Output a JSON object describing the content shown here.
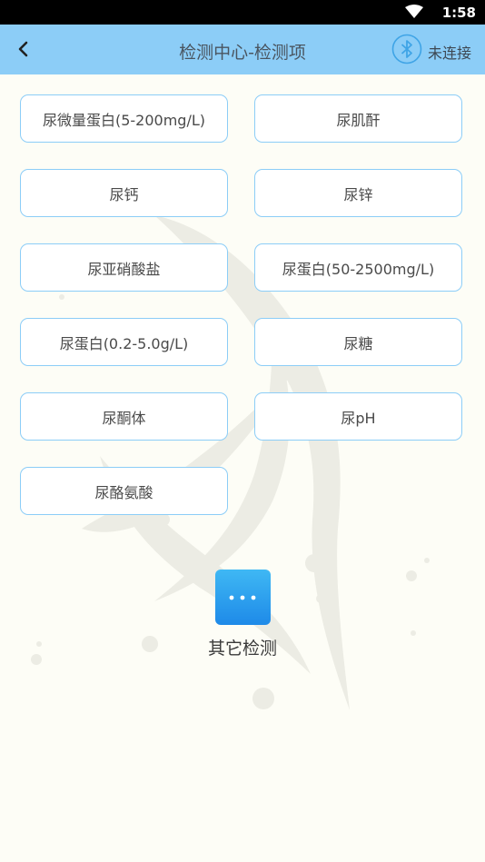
{
  "status_bar": {
    "time": "1:58"
  },
  "app_bar": {
    "title": "检测中心-检测项",
    "bluetooth_status": "未连接"
  },
  "test_items": [
    {
      "label": "尿微量蛋白(5-200mg/L)"
    },
    {
      "label": "尿肌酐"
    },
    {
      "label": "尿钙"
    },
    {
      "label": "尿锌"
    },
    {
      "label": "尿亚硝酸盐"
    },
    {
      "label": "尿蛋白(50-2500mg/L)"
    },
    {
      "label": "尿蛋白(0.2-5.0g/L)"
    },
    {
      "label": "尿糖"
    },
    {
      "label": "尿酮体"
    },
    {
      "label": "尿pH"
    },
    {
      "label": "尿酪氨酸"
    }
  ],
  "other_tests": {
    "label": "其它检测",
    "icon": "more-dots-icon"
  },
  "colors": {
    "app_bar": "#8ccdf7",
    "item_border": "#8ccdf7",
    "background": "#fdfdf6",
    "icon_blue": "#1e8ae8"
  }
}
